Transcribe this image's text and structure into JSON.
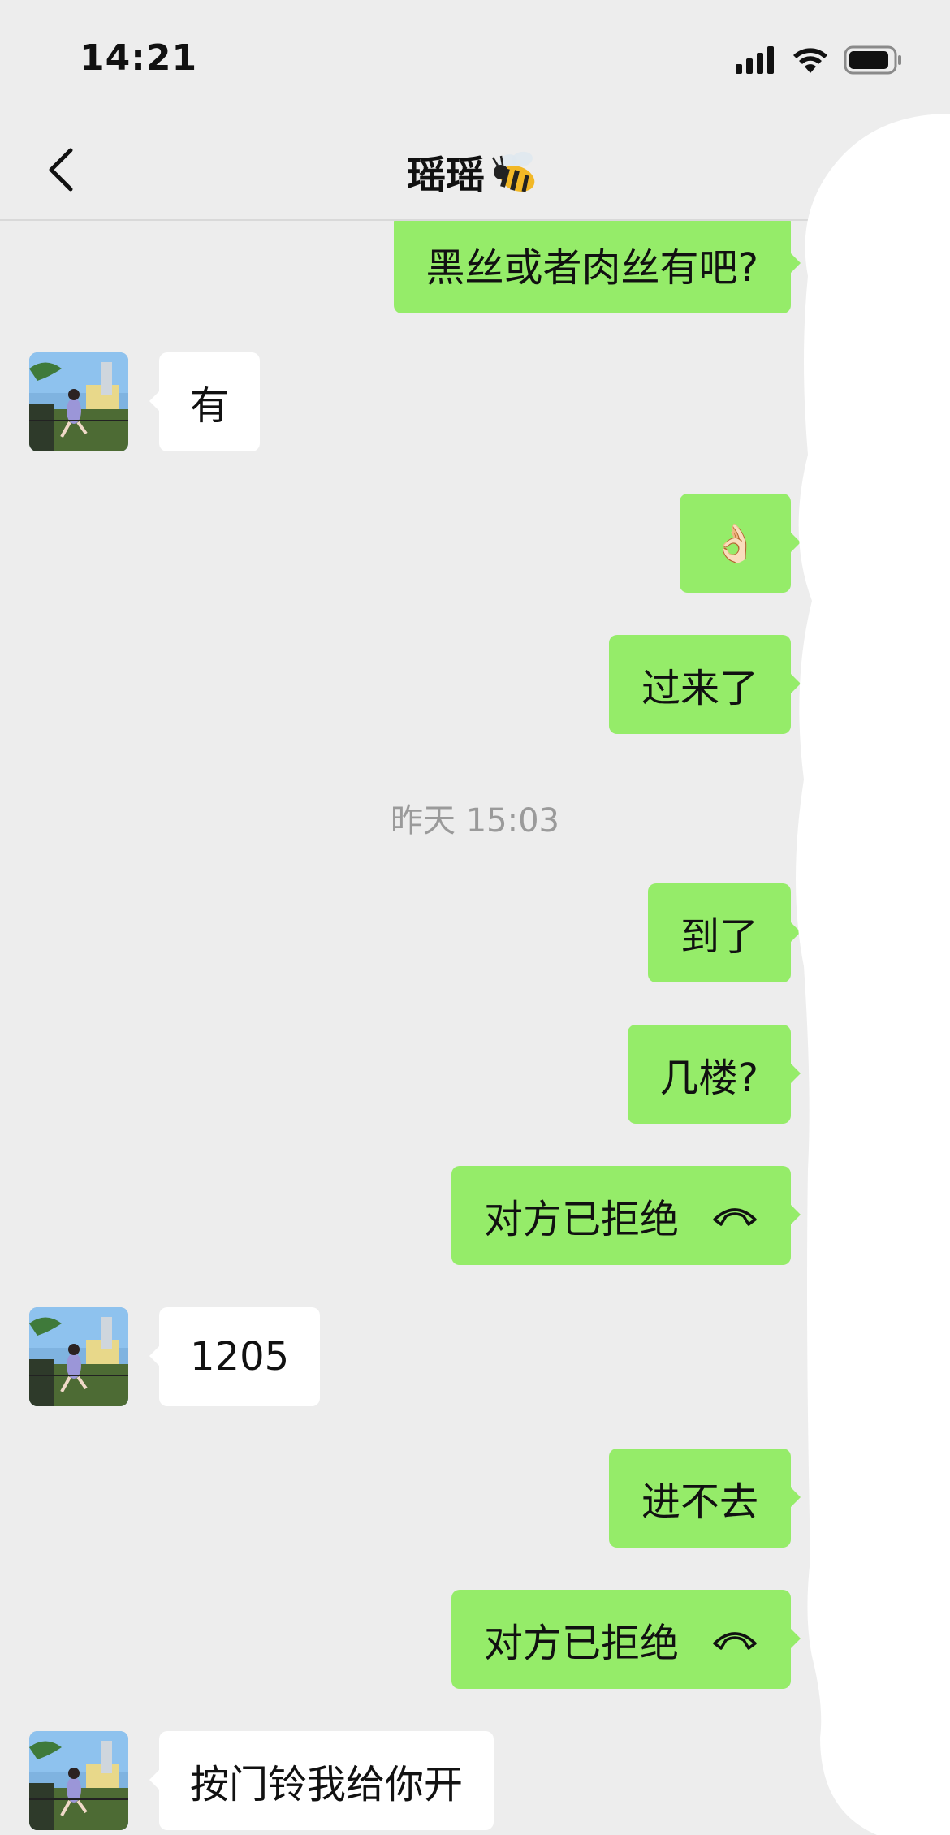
{
  "status_bar": {
    "time": "14:21"
  },
  "nav": {
    "title": "瑶瑶"
  },
  "messages": [
    {
      "side": "out",
      "text": "黑丝或者肉丝有吧?"
    },
    {
      "side": "in",
      "text": "有"
    },
    {
      "side": "out",
      "text": "👌🏻"
    },
    {
      "side": "out",
      "text": "过来了"
    },
    {
      "side": "out",
      "text": "到了"
    },
    {
      "side": "out",
      "text": "几楼?"
    },
    {
      "side": "out",
      "text": "对方已拒绝"
    },
    {
      "side": "in",
      "text": "1205"
    },
    {
      "side": "out",
      "text": "进不去"
    },
    {
      "side": "out",
      "text": "对方已拒绝"
    },
    {
      "side": "in",
      "text": "按门铃我给你开"
    }
  ],
  "timestamp": "昨天 15:03",
  "colors": {
    "background": "#ededed",
    "outgoing_bubble": "#95ec69",
    "incoming_bubble": "#ffffff",
    "timestamp_text": "#9a9a9a"
  }
}
